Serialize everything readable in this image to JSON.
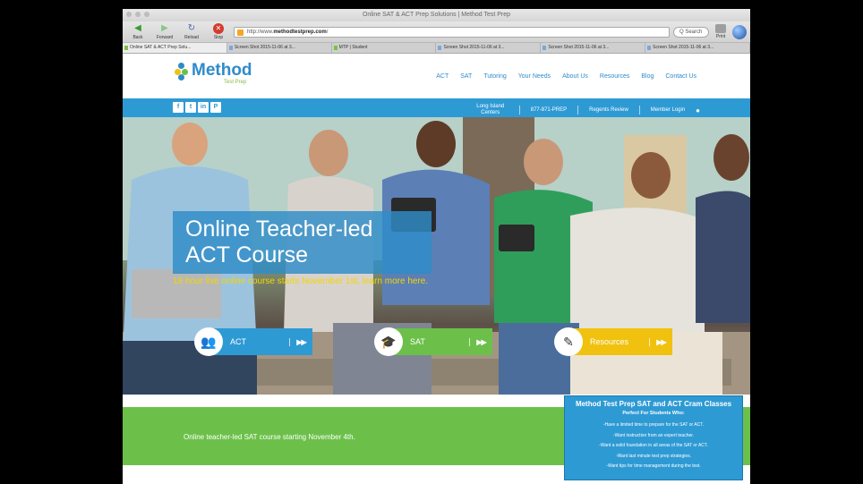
{
  "browser": {
    "window_title": "Online SAT & ACT Prep Solutions | Method Test Prep",
    "back_label": "Back",
    "forward_label": "Forward",
    "reload_label": "Reload",
    "stop_label": "Stop",
    "url_prefix": "http://www.",
    "url_domain": "methodtestprep.com",
    "url_suffix": "/",
    "search_label": "Q Search",
    "print_label": "Print",
    "tabs": [
      "Online SAT & ACT Prep Solu...",
      "Screen Shot 2015-11-06 at 3...",
      "MTP | Student",
      "Screen Shot 2015-11-06 at 3...",
      "Screen Shot 2015-11-06 at 3...",
      "Screen Shot 2015-11-06 at 3..."
    ]
  },
  "site": {
    "logo_text": "Method",
    "logo_sub": "Test Prep",
    "nav": [
      "ACT",
      "SAT",
      "Tutoring",
      "Your Needs",
      "About Us",
      "Resources",
      "Blog",
      "Contact Us"
    ],
    "social": [
      "f",
      "t",
      "in",
      "P"
    ],
    "topnav": {
      "centers": "Long Island Centers",
      "phone": "877-871-PREP",
      "regents": "Regents Review",
      "login": "Member Login"
    }
  },
  "hero": {
    "headline_line1": "Online Teacher-led",
    "headline_line2": "ACT Course",
    "subline": "18 hour live online course starts November 1st, learn more here.",
    "buttons": [
      {
        "label": "ACT",
        "arrows": "▶▶",
        "color": "#2e9ad4"
      },
      {
        "label": "SAT",
        "arrows": "▶▶",
        "color": "#6cc04a"
      },
      {
        "label": "Resources",
        "arrows": "▶▶",
        "color": "#f0c20f"
      }
    ]
  },
  "banner": {
    "text": "Online teacher-led SAT course starting November 4th."
  },
  "cram": {
    "title": "Method Test Prep SAT and ACT Cram Classes",
    "subtitle": "Perfect For Students Who:",
    "items": [
      "-Have a limited time to prepare for the SAT or ACT.",
      "-Want instruction from an expert teacher.",
      "-Want a solid foundation in all areas of the SAT or ACT.",
      "-Want last minute test prep strategies.",
      "-Want tips for time management during the test."
    ]
  },
  "colors": {
    "brand_blue": "#2e9ad4",
    "brand_green": "#6cc04a",
    "brand_yellow": "#f0c20f"
  }
}
